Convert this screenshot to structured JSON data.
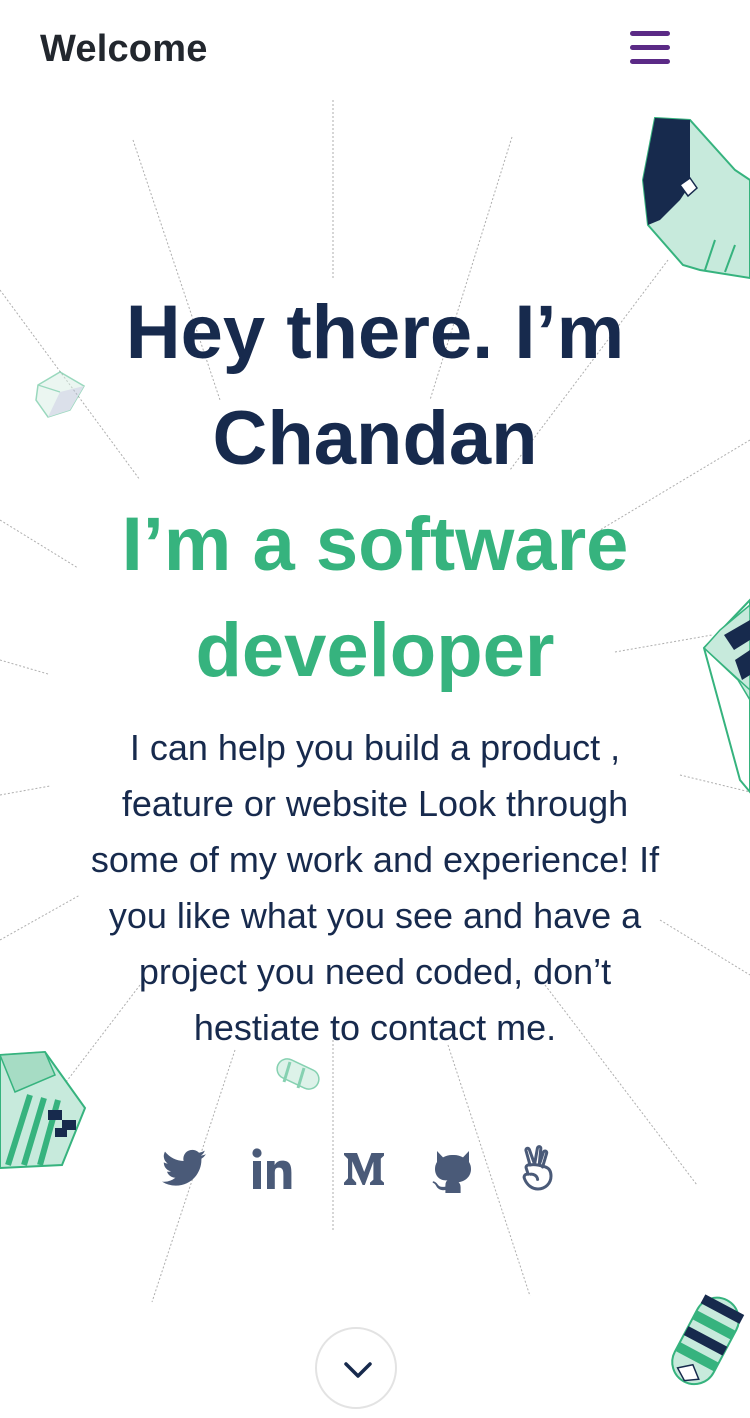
{
  "header": {
    "title": "Welcome",
    "menu_icon": "hamburger-menu-icon"
  },
  "hero": {
    "greeting_lines": [
      "Hey there. I’m",
      "Chandan"
    ],
    "role_lines": [
      "I’m a software",
      "developer"
    ],
    "intro_lines": [
      "I can help you build a product ,",
      "feature or website Look through",
      "some of my work and experience! If",
      "you like what you see and have a",
      "project you need coded, don’t",
      "hestiate to contact me."
    ]
  },
  "socials": [
    {
      "icon": "twitter-icon"
    },
    {
      "icon": "linkedin-icon"
    },
    {
      "icon": "medium-icon"
    },
    {
      "icon": "github-icon"
    },
    {
      "icon": "angellist-icon"
    }
  ],
  "scroll_icon": "chevron-down-icon",
  "colors": {
    "heading": "#172a4d",
    "accent": "#36b37e",
    "menu": "#5b2a86",
    "icons": "#4a5a78"
  }
}
